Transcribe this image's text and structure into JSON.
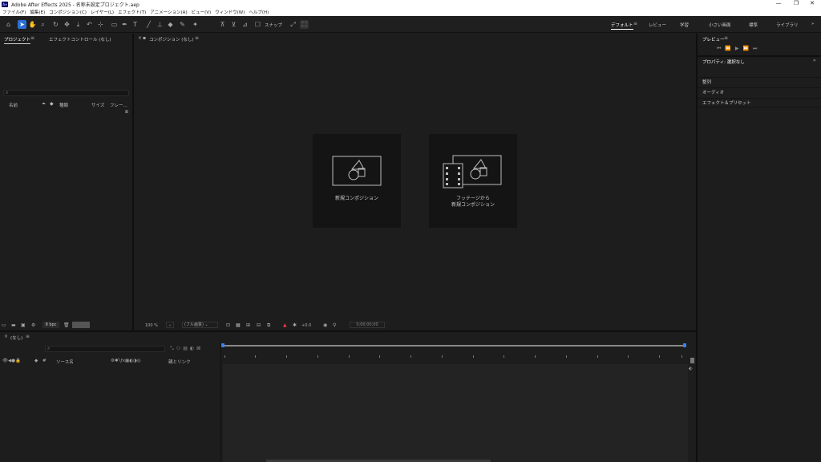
{
  "titlebar": {
    "app_icon": "Ae",
    "title": "Adobe After Effects 2025 - 名称未設定プロジェクト.aep",
    "minimize": "—",
    "maximize": "❐",
    "close": "✕"
  },
  "menu": [
    "ファイル(F)",
    "編集(E)",
    "コンポジション(C)",
    "レイヤー(L)",
    "エフェクト(T)",
    "アニメーション(A)",
    "ビュー(V)",
    "ウィンドウ(W)",
    "ヘルプ(H)"
  ],
  "toolbar": {
    "snap_label": "スナップ",
    "workspaces": [
      "デフォルト",
      "レビュー",
      "学習",
      "小さい画面",
      "標準",
      "ライブラリ"
    ],
    "more": "»"
  },
  "project_panel": {
    "tab_project": "プロジェクト",
    "tab_effects": "エフェクトコントロール (なし)",
    "menu_icon": "≡",
    "columns": [
      "名前",
      "種類",
      "サイズ",
      "フレー..."
    ],
    "bpc": "8 bpc"
  },
  "composition_panel": {
    "close_icon": "×",
    "tab_label": "コンポジション (なし)",
    "menu_icon": "≡",
    "new_comp_label": "新規コンポジション",
    "new_comp_footage_line1": "フッテージから",
    "new_comp_footage_line2": "新規コンポジション",
    "zoom": "100 %",
    "resolution": "(フル画質)",
    "exposure": "+0.0",
    "timecode": "0;00;00;00"
  },
  "right_panel": {
    "preview_tab": "プレビュー",
    "properties_tab": "プロパティ: 選択なし",
    "menu_icon": "≡",
    "more": "»",
    "sections": [
      "整列",
      "オーディオ",
      "エフェクト＆プリセット"
    ]
  },
  "timeline": {
    "close_icon": "×",
    "tab_label": "(なし)",
    "menu_icon": "≡",
    "col_source": "ソース名",
    "col_num": "#",
    "col_parent": "親とリンク"
  },
  "colors": {
    "accent": "#2d6fd6",
    "panel_bg": "#1d1d1d",
    "titlebar_bg": "#ffffff"
  }
}
